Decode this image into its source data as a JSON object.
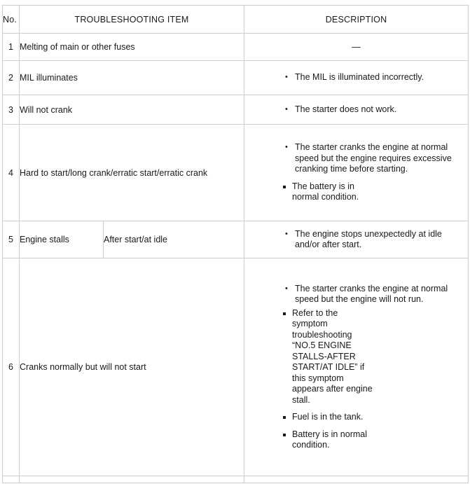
{
  "table": {
    "headers": {
      "no": "No.",
      "item": "TROUBLESHOOTING ITEM",
      "description": "DESCRIPTION"
    },
    "rows": [
      {
        "no": "1",
        "item": "Melting of main or other fuses",
        "sub_item": "",
        "dash": "—",
        "bullets": []
      },
      {
        "no": "2",
        "item": "MIL illuminates",
        "sub_item": "",
        "dash": "",
        "bullets": [
          {
            "text": "The MIL is illuminated incorrectly.",
            "subbullets": []
          }
        ]
      },
      {
        "no": "3",
        "item": "Will not crank",
        "sub_item": "",
        "dash": "",
        "bullets": [
          {
            "text": "The starter does not work.",
            "subbullets": []
          }
        ]
      },
      {
        "no": "4",
        "item": "Hard to start/long crank/erratic start/erratic crank",
        "sub_item": "",
        "dash": "",
        "bullets": [
          {
            "text": "The starter cranks the engine at normal speed but the engine requires excessive cranking time before starting.",
            "subbullets": [
              "The battery is in normal condition."
            ]
          }
        ]
      },
      {
        "no": "5",
        "item": "Engine stalls",
        "sub_item": "After start/at idle",
        "dash": "",
        "bullets": [
          {
            "text": "The engine stops unexpectedly at idle and/or after start.",
            "subbullets": []
          }
        ]
      },
      {
        "no": "6",
        "item": "Cranks normally but will not start",
        "sub_item": "",
        "dash": "",
        "bullets": [
          {
            "text": "The starter cranks the engine at normal speed but the engine will not run.",
            "subbullets": [
              "Refer to the symptom troubleshooting “NO.5 ENGINE STALLS-AFTER START/AT IDLE” if this symptom appears after engine stall.",
              "Fuel is in the tank.",
              "Battery is in normal condition."
            ]
          }
        ]
      }
    ]
  }
}
